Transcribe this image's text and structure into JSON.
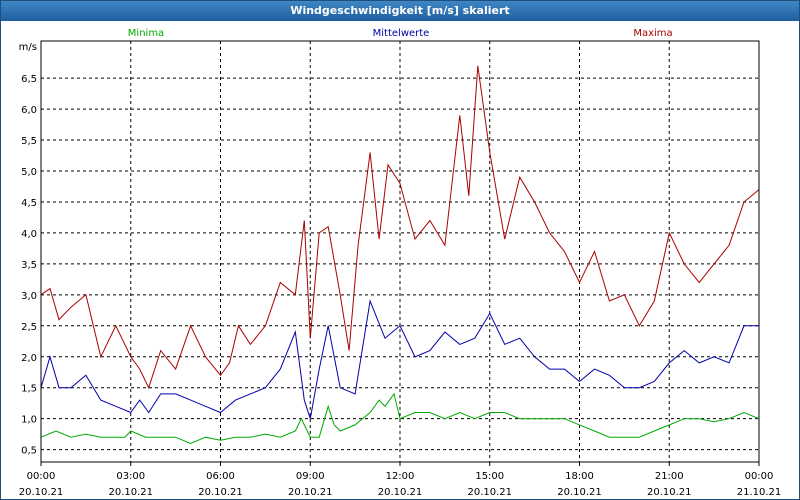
{
  "window": {
    "title": "Windgeschwindigkeit [m/s] skaliert"
  },
  "colors": {
    "titlebar": "#2a6fb0",
    "grid": "#000000",
    "minima": "#00aa00",
    "mittelwerte": "#0000aa",
    "maxima": "#aa0000"
  },
  "chart_data": {
    "type": "line",
    "title": "Windgeschwindigkeit [m/s] skaliert",
    "ylabel": "m/s",
    "xlabel": "",
    "ylim": [
      0.3,
      7.1
    ],
    "yticks": [
      "0,5",
      "1,0",
      "1,5",
      "2,0",
      "2,5",
      "3,0",
      "3,5",
      "4,0",
      "4,5",
      "5,0",
      "5,5",
      "6,0",
      "6,5"
    ],
    "ytick_values": [
      0.5,
      1.0,
      1.5,
      2.0,
      2.5,
      3.0,
      3.5,
      4.0,
      4.5,
      5.0,
      5.5,
      6.0,
      6.5
    ],
    "xlim_hours": [
      0,
      24
    ],
    "xticks": [
      {
        "time": "00:00",
        "date": "20.10.21",
        "hour": 0
      },
      {
        "time": "03:00",
        "date": "20.10.21",
        "hour": 3
      },
      {
        "time": "06:00",
        "date": "20.10.21",
        "hour": 6
      },
      {
        "time": "09:00",
        "date": "20.10.21",
        "hour": 9
      },
      {
        "time": "12:00",
        "date": "20.10.21",
        "hour": 12
      },
      {
        "time": "15:00",
        "date": "20.10.21",
        "hour": 15
      },
      {
        "time": "18:00",
        "date": "20.10.21",
        "hour": 18
      },
      {
        "time": "21:00",
        "date": "20.10.21",
        "hour": 21
      },
      {
        "time": "00:00",
        "date": "21.10.21",
        "hour": 24
      }
    ],
    "grid": true,
    "legend_position": "top",
    "series": [
      {
        "name": "Minima",
        "x": [
          0,
          0.5,
          1,
          1.5,
          2,
          2.5,
          2.8,
          3,
          3.5,
          4,
          4.5,
          5,
          5.5,
          6,
          6.5,
          7,
          7.5,
          8,
          8.5,
          8.7,
          9,
          9.3,
          9.6,
          9.8,
          10,
          10.5,
          11,
          11.3,
          11.5,
          11.8,
          12,
          12.5,
          13,
          13.5,
          14,
          14.5,
          15,
          15.5,
          16,
          16.5,
          17,
          17.5,
          18,
          18.5,
          19,
          19.5,
          20,
          20.5,
          21,
          21.5,
          22,
          22.5,
          23,
          23.5,
          24
        ],
        "values": [
          0.7,
          0.8,
          0.7,
          0.75,
          0.7,
          0.7,
          0.7,
          0.8,
          0.7,
          0.7,
          0.7,
          0.6,
          0.7,
          0.65,
          0.7,
          0.7,
          0.75,
          0.7,
          0.8,
          1.0,
          0.7,
          0.7,
          1.2,
          0.9,
          0.8,
          0.9,
          1.1,
          1.3,
          1.2,
          1.4,
          1.0,
          1.1,
          1.1,
          1.0,
          1.1,
          1.0,
          1.1,
          1.1,
          1.0,
          1.0,
          1.0,
          1.0,
          0.9,
          0.8,
          0.7,
          0.7,
          0.7,
          0.8,
          0.9,
          1.0,
          1.0,
          0.95,
          1.0,
          1.1,
          1.0
        ]
      },
      {
        "name": "Mittelwerte",
        "x": [
          0,
          0.3,
          0.6,
          1,
          1.5,
          2,
          2.5,
          3,
          3.3,
          3.6,
          4,
          4.5,
          5,
          5.5,
          6,
          6.5,
          7,
          7.5,
          8,
          8.5,
          8.8,
          9,
          9.3,
          9.6,
          10,
          10.5,
          11,
          11.5,
          12,
          12.5,
          13,
          13.5,
          14,
          14.5,
          15,
          15.5,
          16,
          16.5,
          17,
          17.5,
          18,
          18.5,
          19,
          19.5,
          20,
          20.5,
          21,
          21.5,
          22,
          22.5,
          23,
          23.5,
          24
        ],
        "values": [
          1.5,
          2.0,
          1.5,
          1.5,
          1.7,
          1.3,
          1.2,
          1.1,
          1.3,
          1.1,
          1.4,
          1.4,
          1.3,
          1.2,
          1.1,
          1.3,
          1.4,
          1.5,
          1.8,
          2.4,
          1.3,
          1.0,
          1.8,
          2.5,
          1.5,
          1.4,
          2.9,
          2.3,
          2.5,
          2.0,
          2.1,
          2.4,
          2.2,
          2.3,
          2.7,
          2.2,
          2.3,
          2.0,
          1.8,
          1.8,
          1.6,
          1.8,
          1.7,
          1.5,
          1.5,
          1.6,
          1.9,
          2.1,
          1.9,
          2.0,
          1.9,
          2.5,
          2.5
        ]
      },
      {
        "name": "Maxima",
        "x": [
          0,
          0.3,
          0.6,
          1,
          1.5,
          2,
          2.5,
          3,
          3.3,
          3.6,
          4,
          4.5,
          5,
          5.5,
          6,
          6.3,
          6.6,
          7,
          7.5,
          8,
          8.5,
          8.8,
          9,
          9.3,
          9.6,
          10,
          10.3,
          10.6,
          11,
          11.3,
          11.6,
          12,
          12.5,
          13,
          13.5,
          14,
          14.3,
          14.6,
          15,
          15.5,
          16,
          16.5,
          17,
          17.5,
          18,
          18.5,
          19,
          19.5,
          20,
          20.5,
          21,
          21.5,
          22,
          22.5,
          23,
          23.5,
          24
        ],
        "values": [
          3.0,
          3.1,
          2.6,
          2.8,
          3.0,
          2.0,
          2.5,
          2.0,
          1.8,
          1.5,
          2.1,
          1.8,
          2.5,
          2.0,
          1.7,
          1.9,
          2.5,
          2.2,
          2.5,
          3.2,
          3.0,
          4.2,
          2.3,
          4.0,
          4.1,
          3.0,
          2.1,
          3.8,
          5.3,
          3.9,
          5.1,
          4.8,
          3.9,
          4.2,
          3.8,
          5.9,
          4.6,
          6.7,
          5.3,
          3.9,
          4.9,
          4.5,
          4.0,
          3.7,
          3.2,
          3.7,
          2.9,
          3.0,
          2.5,
          2.9,
          4.0,
          3.5,
          3.2,
          3.5,
          3.8,
          4.5,
          4.7
        ]
      }
    ]
  }
}
